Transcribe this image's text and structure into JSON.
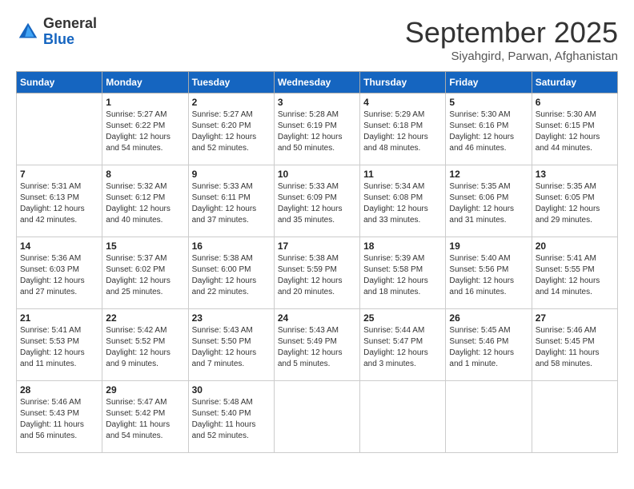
{
  "logo": {
    "general": "General",
    "blue": "Blue"
  },
  "header": {
    "month": "September 2025",
    "location": "Siyahgird, Parwan, Afghanistan"
  },
  "weekdays": [
    "Sunday",
    "Monday",
    "Tuesday",
    "Wednesday",
    "Thursday",
    "Friday",
    "Saturday"
  ],
  "weeks": [
    [
      {
        "day": null
      },
      {
        "day": 1,
        "sunrise": "5:27 AM",
        "sunset": "6:22 PM",
        "daylight": "12 hours and 54 minutes."
      },
      {
        "day": 2,
        "sunrise": "5:27 AM",
        "sunset": "6:20 PM",
        "daylight": "12 hours and 52 minutes."
      },
      {
        "day": 3,
        "sunrise": "5:28 AM",
        "sunset": "6:19 PM",
        "daylight": "12 hours and 50 minutes."
      },
      {
        "day": 4,
        "sunrise": "5:29 AM",
        "sunset": "6:18 PM",
        "daylight": "12 hours and 48 minutes."
      },
      {
        "day": 5,
        "sunrise": "5:30 AM",
        "sunset": "6:16 PM",
        "daylight": "12 hours and 46 minutes."
      },
      {
        "day": 6,
        "sunrise": "5:30 AM",
        "sunset": "6:15 PM",
        "daylight": "12 hours and 44 minutes."
      }
    ],
    [
      {
        "day": 7,
        "sunrise": "5:31 AM",
        "sunset": "6:13 PM",
        "daylight": "12 hours and 42 minutes."
      },
      {
        "day": 8,
        "sunrise": "5:32 AM",
        "sunset": "6:12 PM",
        "daylight": "12 hours and 40 minutes."
      },
      {
        "day": 9,
        "sunrise": "5:33 AM",
        "sunset": "6:11 PM",
        "daylight": "12 hours and 37 minutes."
      },
      {
        "day": 10,
        "sunrise": "5:33 AM",
        "sunset": "6:09 PM",
        "daylight": "12 hours and 35 minutes."
      },
      {
        "day": 11,
        "sunrise": "5:34 AM",
        "sunset": "6:08 PM",
        "daylight": "12 hours and 33 minutes."
      },
      {
        "day": 12,
        "sunrise": "5:35 AM",
        "sunset": "6:06 PM",
        "daylight": "12 hours and 31 minutes."
      },
      {
        "day": 13,
        "sunrise": "5:35 AM",
        "sunset": "6:05 PM",
        "daylight": "12 hours and 29 minutes."
      }
    ],
    [
      {
        "day": 14,
        "sunrise": "5:36 AM",
        "sunset": "6:03 PM",
        "daylight": "12 hours and 27 minutes."
      },
      {
        "day": 15,
        "sunrise": "5:37 AM",
        "sunset": "6:02 PM",
        "daylight": "12 hours and 25 minutes."
      },
      {
        "day": 16,
        "sunrise": "5:38 AM",
        "sunset": "6:00 PM",
        "daylight": "12 hours and 22 minutes."
      },
      {
        "day": 17,
        "sunrise": "5:38 AM",
        "sunset": "5:59 PM",
        "daylight": "12 hours and 20 minutes."
      },
      {
        "day": 18,
        "sunrise": "5:39 AM",
        "sunset": "5:58 PM",
        "daylight": "12 hours and 18 minutes."
      },
      {
        "day": 19,
        "sunrise": "5:40 AM",
        "sunset": "5:56 PM",
        "daylight": "12 hours and 16 minutes."
      },
      {
        "day": 20,
        "sunrise": "5:41 AM",
        "sunset": "5:55 PM",
        "daylight": "12 hours and 14 minutes."
      }
    ],
    [
      {
        "day": 21,
        "sunrise": "5:41 AM",
        "sunset": "5:53 PM",
        "daylight": "12 hours and 11 minutes."
      },
      {
        "day": 22,
        "sunrise": "5:42 AM",
        "sunset": "5:52 PM",
        "daylight": "12 hours and 9 minutes."
      },
      {
        "day": 23,
        "sunrise": "5:43 AM",
        "sunset": "5:50 PM",
        "daylight": "12 hours and 7 minutes."
      },
      {
        "day": 24,
        "sunrise": "5:43 AM",
        "sunset": "5:49 PM",
        "daylight": "12 hours and 5 minutes."
      },
      {
        "day": 25,
        "sunrise": "5:44 AM",
        "sunset": "5:47 PM",
        "daylight": "12 hours and 3 minutes."
      },
      {
        "day": 26,
        "sunrise": "5:45 AM",
        "sunset": "5:46 PM",
        "daylight": "12 hours and 1 minute."
      },
      {
        "day": 27,
        "sunrise": "5:46 AM",
        "sunset": "5:45 PM",
        "daylight": "11 hours and 58 minutes."
      }
    ],
    [
      {
        "day": 28,
        "sunrise": "5:46 AM",
        "sunset": "5:43 PM",
        "daylight": "11 hours and 56 minutes."
      },
      {
        "day": 29,
        "sunrise": "5:47 AM",
        "sunset": "5:42 PM",
        "daylight": "11 hours and 54 minutes."
      },
      {
        "day": 30,
        "sunrise": "5:48 AM",
        "sunset": "5:40 PM",
        "daylight": "11 hours and 52 minutes."
      },
      {
        "day": null
      },
      {
        "day": null
      },
      {
        "day": null
      },
      {
        "day": null
      }
    ]
  ]
}
